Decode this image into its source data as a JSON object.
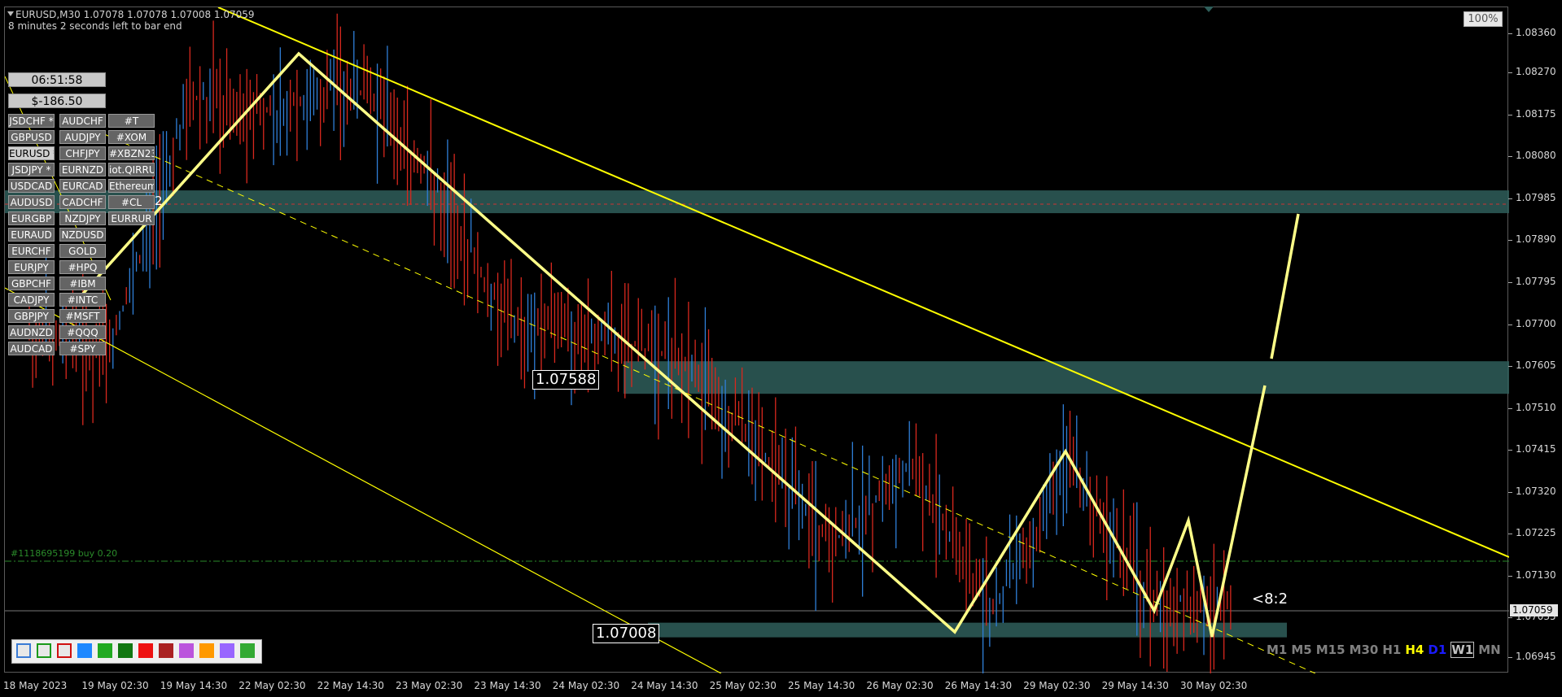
{
  "header": {
    "symbol_line": "EURUSD,M30  1.07078 1.07078 1.07008 1.07059",
    "bar_timer": "8 minutes 2 seconds left to bar end",
    "zoom": "100%"
  },
  "panel": {
    "clock": "06:51:58",
    "profit": "$-186.50",
    "symbols_col1": [
      "JSDCHF *",
      "GBPUSD",
      "EURUSD *",
      "JSDJPY *",
      "USDCAD",
      "AUDUSD",
      "EURGBP",
      "EURAUD",
      "EURCHF",
      "EURJPY",
      "GBPCHF",
      "CADJPY",
      "GBPJPY",
      "AUDNZD",
      "AUDCAD"
    ],
    "symbols_col2": [
      "AUDCHF",
      "AUDJPY",
      "CHFJPY",
      "EURNZD",
      "EURCAD",
      "CADCHF",
      "NZDJPY",
      "NZDUSD",
      "GOLD",
      "#HPQ",
      "#IBM",
      "#INTC",
      "#MSFT",
      "#QQQ",
      "#SPY"
    ],
    "symbols_col3": [
      "#T",
      "#XOM",
      "#XBZN23",
      "iot.QIRRU",
      "Ethereum",
      "#CL",
      "EURRUR"
    ]
  },
  "labels": {
    "zone_price_upper": "1.07588",
    "zone_price_lower": "1.07008",
    "ratio": "<8:2",
    "order": "#1118695199 buy 0.20",
    "current_price": "1.07059",
    "cl_suffix": "2"
  },
  "timeframes": [
    "M1",
    "M5",
    "M15",
    "M30",
    "H1",
    "H4",
    "D1",
    "W1",
    "MN"
  ],
  "toolbar": {
    "swatches": [
      "#3a7bd5",
      "#1a9a1a",
      "#d01010",
      "#1e88ff",
      "#22aa22",
      "#117711",
      "#ee1111",
      "#aa2222",
      "#bb55dd",
      "#ff9900",
      "#9966ff",
      "#33aa33"
    ]
  },
  "chart_data": {
    "type": "line",
    "title": "EURUSD,M30",
    "ylim": [
      1.0691,
      1.0842
    ],
    "y_ticks": [
      "1.08360",
      "1.08270",
      "1.08175",
      "1.08080",
      "1.07985",
      "1.07890",
      "1.07795",
      "1.07700",
      "1.07605",
      "1.07510",
      "1.07415",
      "1.07320",
      "1.07225",
      "1.07130",
      "1.07035",
      "1.06945"
    ],
    "x_ticks": [
      "18 May 2023",
      "19 May 02:30",
      "19 May 14:30",
      "22 May 02:30",
      "22 May 14:30",
      "23 May 02:30",
      "23 May 14:30",
      "24 May 02:30",
      "24 May 14:30",
      "25 May 02:30",
      "25 May 14:30",
      "26 May 02:30",
      "26 May 14:30",
      "29 May 02:30",
      "29 May 14:30",
      "30 May 02:30"
    ],
    "series": [
      {
        "name": "",
        "color": "#d8281e",
        "x": [
          "18 May 2023",
          "19 May 02:30",
          "19 May 14:30",
          "22 May 02:30",
          "22 May 14:30",
          "23 May 02:30",
          "23 May 14:30",
          "24 May 02:30",
          "24 May 14:30",
          "25 May 02:30",
          "25 May 14:30",
          "26 May 02:30",
          "26 May 14:30",
          "29 May 02:30",
          "29 May 14:30",
          "30 May 02:30"
        ],
        "values": [
          1.0768,
          1.0763,
          1.0822,
          1.0818,
          1.0825,
          1.0804,
          1.077,
          1.0768,
          1.0763,
          1.0745,
          1.072,
          1.0738,
          1.0705,
          1.0738,
          1.0708,
          1.0706
        ]
      }
    ],
    "zones": [
      {
        "from": 1.07985,
        "to": 1.08005,
        "color": "#2f5e5a"
      },
      {
        "from": 1.0753,
        "to": 1.0759,
        "color": "#2f5e5a"
      },
      {
        "from": 1.07008,
        "to": 1.07025,
        "color": "#2f5e5a"
      }
    ],
    "grid": false
  }
}
